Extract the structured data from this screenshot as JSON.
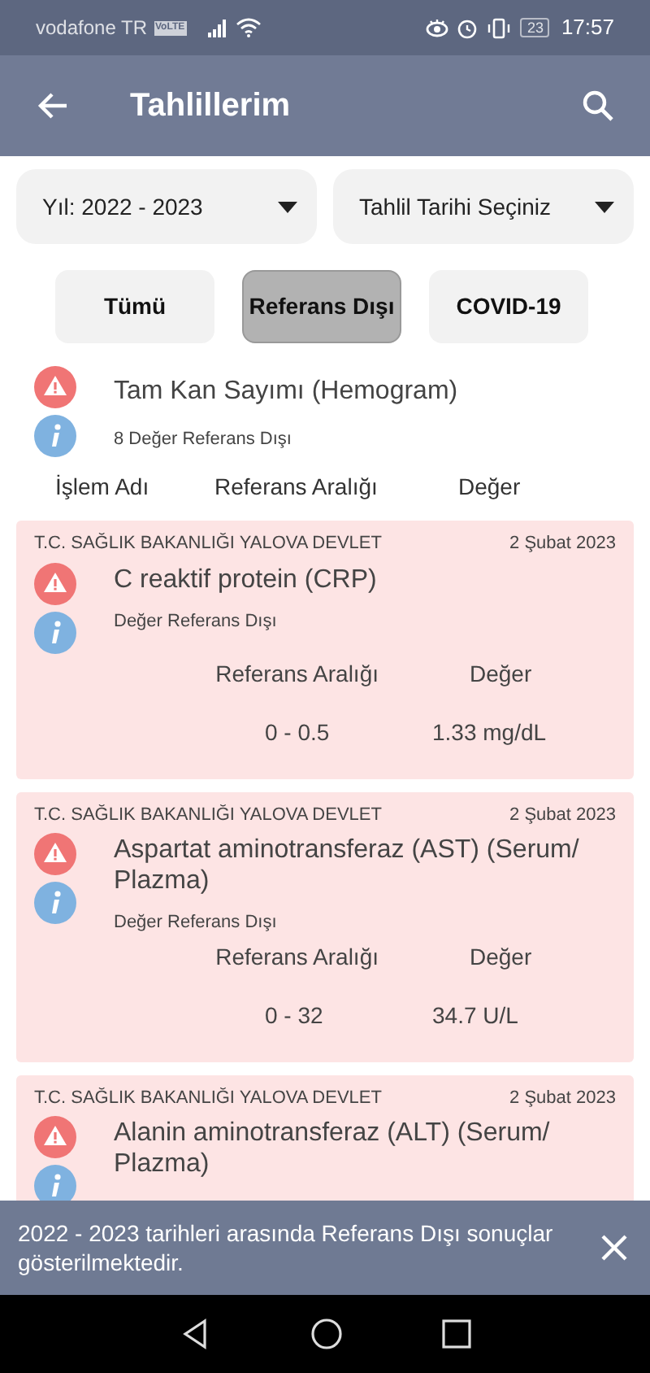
{
  "status_bar": {
    "carrier": "vodafone TR",
    "volte": "VoLTE",
    "battery": "23",
    "time": "17:57"
  },
  "app_bar": {
    "title": "Tahlillerim"
  },
  "dropdowns": [
    {
      "label": "Yıl: 2022 - 2023"
    },
    {
      "label": "Tahlil Tarihi Seçiniz"
    }
  ],
  "filters": [
    {
      "label": "Tümü",
      "selected": false
    },
    {
      "label": "Referans Dışı",
      "selected": true
    },
    {
      "label": "COVID-19",
      "selected": false
    }
  ],
  "group": {
    "title": "Tam Kan Sayımı (Hemogram)",
    "subtitle": "8 Değer Referans Dışı",
    "columns": [
      "İşlem Adı",
      "Referans Aralığı",
      "Değer"
    ]
  },
  "results": [
    {
      "hospital": "T.C. SAĞLIK BAKANLIĞI YALOVA DEVLET",
      "date": "2 Şubat 2023",
      "name": "C reaktif protein (CRP)",
      "status": "Değer Referans Dışı",
      "range_label": "Referans Aralığı",
      "value_label": "Değer",
      "range": "0 - 0.5",
      "value": "1.33 mg/dL"
    },
    {
      "hospital": "T.C. SAĞLIK BAKANLIĞI YALOVA DEVLET",
      "date": "2 Şubat 2023",
      "name": "Aspartat aminotransferaz (AST) (Serum/ Plazma)",
      "status": "Değer Referans Dışı",
      "range_label": "Referans Aralığı",
      "value_label": "Değer",
      "range": "0 - 32",
      "value": "34.7 U/L"
    },
    {
      "hospital": "T.C. SAĞLIK BAKANLIĞI YALOVA DEVLET",
      "date": "2 Şubat 2023",
      "name": "Alanin aminotransferaz (ALT) (Serum/ Plazma)"
    }
  ],
  "snackbar": {
    "message": "2022 - 2023 tarihleri arasında Referans Dışı sonuçlar gösterilmektedir."
  }
}
